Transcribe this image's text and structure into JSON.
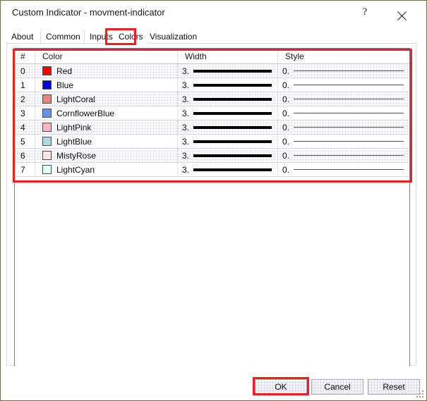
{
  "window": {
    "title": "Custom Indicator - movment-indicator",
    "help_label": "?",
    "close_label": "×"
  },
  "tabs": [
    {
      "label": "About",
      "selected": false
    },
    {
      "label": "Common",
      "selected": false
    },
    {
      "label": "Inputs",
      "selected": false
    },
    {
      "label": "Colors",
      "selected": true
    },
    {
      "label": "Visualization",
      "selected": false
    }
  ],
  "grid": {
    "headers": {
      "index": "#",
      "color": "Color",
      "width": "Width",
      "style": "Style"
    },
    "rows": [
      {
        "index": "0",
        "color_name": "Red",
        "color_hex": "#FF0000",
        "width": "3.",
        "style": "0."
      },
      {
        "index": "1",
        "color_name": "Blue",
        "color_hex": "#0000EE",
        "width": "3.",
        "style": "0."
      },
      {
        "index": "2",
        "color_name": "LightCoral",
        "color_hex": "#F08080",
        "width": "3.",
        "style": "0."
      },
      {
        "index": "3",
        "color_name": "CornflowerBlue",
        "color_hex": "#6495ED",
        "width": "3.",
        "style": "0."
      },
      {
        "index": "4",
        "color_name": "LightPink",
        "color_hex": "#FFB6C1",
        "width": "3.",
        "style": "0."
      },
      {
        "index": "5",
        "color_name": "LightBlue",
        "color_hex": "#ADD8E6",
        "width": "3.",
        "style": "0."
      },
      {
        "index": "6",
        "color_name": "MistyRose",
        "color_hex": "#FFE4E1",
        "width": "3.",
        "style": "0."
      },
      {
        "index": "7",
        "color_name": "LightCyan",
        "color_hex": "#E0FFFF",
        "width": "3.",
        "style": "0."
      }
    ]
  },
  "footer": {
    "ok_label": "OK",
    "cancel_label": "Cancel",
    "reset_label": "Reset"
  },
  "annotations": {
    "highlight_color": "#fc1b1b"
  }
}
